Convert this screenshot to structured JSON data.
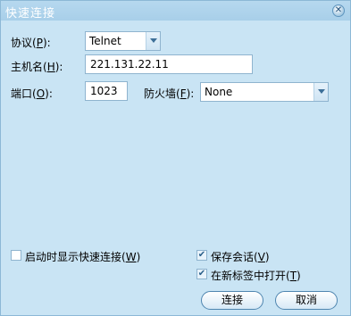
{
  "window": {
    "title": "快速连接"
  },
  "protocol": {
    "label": "协议(",
    "key": "P",
    "suffix": "):",
    "value": "Telnet"
  },
  "hostname": {
    "label": "主机名(",
    "key": "H",
    "suffix": "):",
    "value": "221.131.22.11"
  },
  "port": {
    "label": "端口(",
    "key": "O",
    "suffix": "):",
    "value": "1023"
  },
  "firewall": {
    "label": "防火墙(",
    "key": "F",
    "suffix": "):",
    "value": "None"
  },
  "options": {
    "show_on_startup": {
      "label": "启动时显示快速连接(",
      "key": "W",
      "suffix": ")",
      "checked": false
    },
    "save_session": {
      "label": "保存会话(",
      "key": "V",
      "suffix": ")",
      "checked": true
    },
    "open_in_tab": {
      "label": "在新标签中打开(",
      "key": "T",
      "suffix": ")",
      "checked": true
    }
  },
  "buttons": {
    "connect": "连接",
    "cancel": "取消"
  },
  "colors": {
    "background": "#c9e4f4",
    "titlebar": "#b0d4ec",
    "border": "#8fb4cf"
  },
  "icons": {
    "close": "close-icon",
    "dropdown": "chevron-down-icon",
    "check": "checkmark-icon"
  }
}
